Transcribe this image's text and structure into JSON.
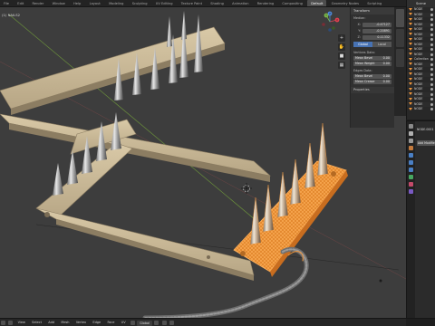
{
  "workspace_tabs": [
    "File",
    "Edit",
    "Render",
    "Window",
    "Help",
    "Layout",
    "Modeling",
    "Sculpting",
    "UV Editing",
    "Texture Paint",
    "Shading",
    "Animation",
    "Rendering",
    "Compositing",
    "Default",
    "Geometry Nodes",
    "Scripting",
    "UV Editing",
    "Node Editing"
  ],
  "active_tab": "Default",
  "viewport": {
    "mode_label": "(1) NAILS2"
  },
  "gizmo": {
    "x": "X",
    "y": "Y",
    "z": "Z"
  },
  "npanel": {
    "transform_header": "Transform",
    "median_label": "Median:",
    "x_label": "X:",
    "x_value": "-0.47127",
    "y_label": "Y:",
    "y_value": "-0.20891",
    "z_label": "Z:",
    "z_value": "0.11332",
    "global_label": "Global",
    "local_label": "Local",
    "vertices_data_label": "Vertices Data:",
    "mean_bevel_label": "Mean Bevel",
    "mean_bevel_value": "0.00",
    "mean_vgroup_label": "Mean Weight",
    "mean_vgroup_value": "0.00",
    "edges_data_label": "Edges Data:",
    "edge_bevel_label": "Mean Bevel",
    "edge_bevel_value": "0.00",
    "edge_crease_label": "Mean Crease",
    "edge_crease_value": "0.00",
    "properties_header": "Properties"
  },
  "outliner": {
    "title": "Scene",
    "rows": [
      "NODE",
      "NODE",
      "NODE",
      "NODE",
      "NODE",
      "NODE",
      "NODE",
      "NODE",
      "NODE",
      "NODE",
      "Collection",
      "NODE",
      "NODE",
      "NODE",
      "NODE",
      "NODE",
      "NODE",
      "NODE",
      "NODE",
      "NODE",
      "NODE"
    ]
  },
  "properties": {
    "object_title": "NODE.0001",
    "add_modifier_label": "Add Modifier"
  },
  "bottom_header": {
    "items": [
      "View",
      "Select",
      "Add",
      "Mesh",
      "Vertex",
      "Edge",
      "Face",
      "UV"
    ],
    "transform_orientation": "Global"
  },
  "colors": {
    "selection": "#f0953a",
    "active_accent": "#4772b3",
    "viewport_bg": "#3d3d3d"
  }
}
